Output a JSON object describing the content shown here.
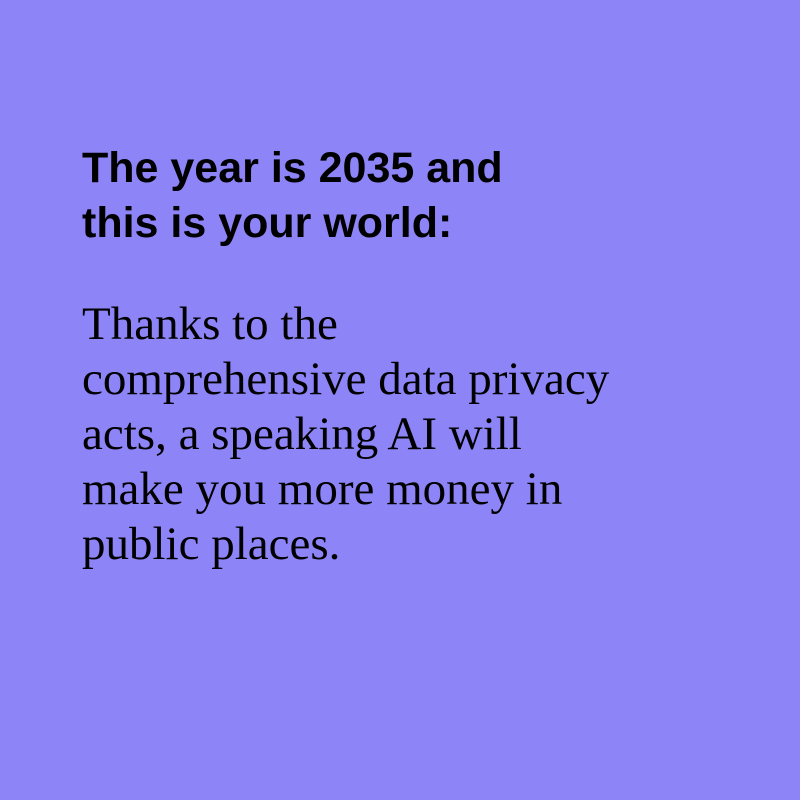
{
  "colors": {
    "background": "#8d84f7",
    "text": "#000000"
  },
  "heading": {
    "lines": [
      "The year is 2035 and",
      "this is your world:"
    ]
  },
  "body": {
    "lines": [
      "Thanks to the",
      "comprehensive data privacy",
      "acts, a speaking AI will",
      "make you more money in",
      "public places."
    ]
  }
}
